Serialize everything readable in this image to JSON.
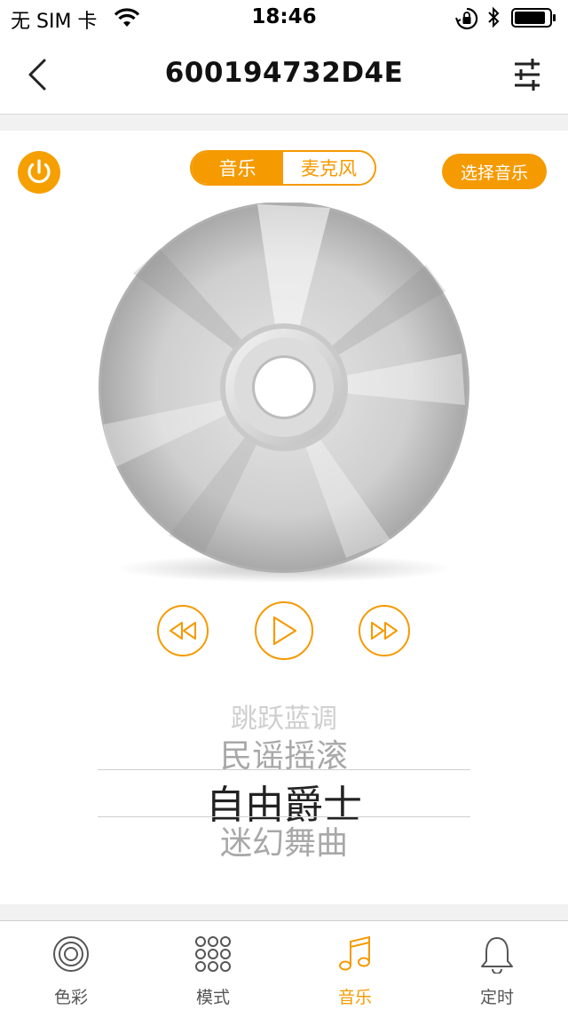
{
  "status_bar": {
    "carrier": "无 SIM 卡",
    "time": "18:46"
  },
  "nav": {
    "title": "600194732D4E",
    "back_icon": "chevron-left-icon",
    "settings_icon": "sliders-icon"
  },
  "controls": {
    "power_icon": "power-icon",
    "segment": [
      {
        "label": "音乐",
        "active": true
      },
      {
        "label": "麦克风",
        "active": false
      }
    ],
    "choose_music_label": "选择音乐"
  },
  "player": {
    "prev_icon": "rewind-icon",
    "play_icon": "play-icon",
    "next_icon": "fast-forward-icon"
  },
  "songs": [
    "跳跃蓝调",
    "民谣摇滚",
    "自由爵士",
    "迷幻舞曲"
  ],
  "selected_song_index": 2,
  "tabs": [
    {
      "label": "色彩",
      "icon": "color-rings-icon",
      "active": false
    },
    {
      "label": "模式",
      "icon": "grid-dots-icon",
      "active": false
    },
    {
      "label": "音乐",
      "icon": "music-note-icon",
      "active": true
    },
    {
      "label": "定时",
      "icon": "bell-icon",
      "active": false
    }
  ],
  "colors": {
    "accent": "#F59A00",
    "divider": "#D8D8D8",
    "inactive_text": "#555555"
  }
}
